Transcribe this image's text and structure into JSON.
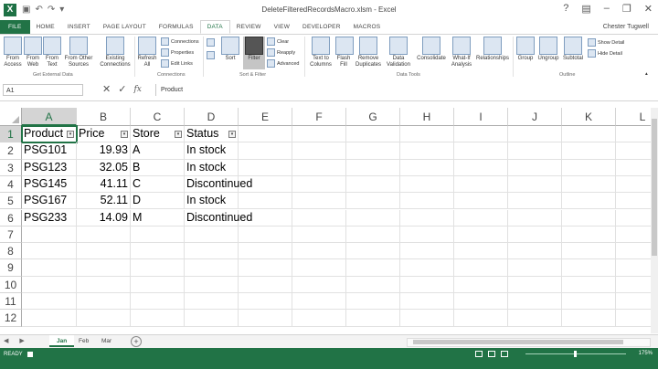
{
  "window": {
    "app_icon": "X",
    "title": "DeleteFilteredRecordsMacro.xlsm - Excel",
    "user": "Chester Tugwell"
  },
  "tabs": [
    "FILE",
    "HOME",
    "INSERT",
    "PAGE LAYOUT",
    "FORMULAS",
    "DATA",
    "REVIEW",
    "VIEW",
    "DEVELOPER",
    "MACROS"
  ],
  "active_tab": "DATA",
  "ribbon": {
    "get_external": {
      "label": "Get External Data",
      "buttons": [
        "From Access",
        "From Web",
        "From Text",
        "From Other Sources"
      ],
      "existing": "Existing Connections"
    },
    "connections": {
      "label": "Connections",
      "refresh": "Refresh All",
      "items": [
        "Connections",
        "Properties",
        "Edit Links"
      ]
    },
    "sort_filter": {
      "label": "Sort & Filter",
      "sort": "Sort",
      "filter": "Filter",
      "items": [
        "Clear",
        "Reapply",
        "Advanced"
      ]
    },
    "data_tools": {
      "label": "Data Tools",
      "buttons": [
        "Text to Columns",
        "Flash Fill",
        "Remove Duplicates",
        "Data Validation",
        "Consolidate",
        "What-If Analysis",
        "Relationships"
      ]
    },
    "outline": {
      "label": "Outline",
      "buttons": [
        "Group",
        "Ungroup",
        "Subtotal"
      ],
      "items": [
        "Show Detail",
        "Hide Detail"
      ]
    }
  },
  "formula_bar": {
    "name_box": "A1",
    "fx": "fx",
    "content": "Product"
  },
  "columns": [
    "A",
    "B",
    "C",
    "D",
    "E",
    "F",
    "G",
    "H",
    "I",
    "J",
    "K",
    "L"
  ],
  "rows": [
    "1",
    "2",
    "3",
    "4",
    "5",
    "6",
    "7",
    "8",
    "9",
    "10",
    "11",
    "12"
  ],
  "table": {
    "headers": [
      "Product",
      "Price",
      "Store",
      "Status"
    ],
    "rows": [
      [
        "PSG101",
        "19.93",
        "A",
        "In stock"
      ],
      [
        "PSG123",
        "32.05",
        "B",
        "In stock"
      ],
      [
        "PSG145",
        "41.11",
        "C",
        "Discontinued"
      ],
      [
        "PSG167",
        "52.11",
        "D",
        "In stock"
      ],
      [
        "PSG233",
        "14.09",
        "M",
        "Discontinued"
      ]
    ]
  },
  "sheets": [
    "Jan",
    "Feb",
    "Mar"
  ],
  "active_sheet": "Jan",
  "status": {
    "ready": "READY",
    "zoom": "175%"
  },
  "colors": {
    "excel_green": "#217346",
    "header_selected": "#d4d4d4"
  }
}
